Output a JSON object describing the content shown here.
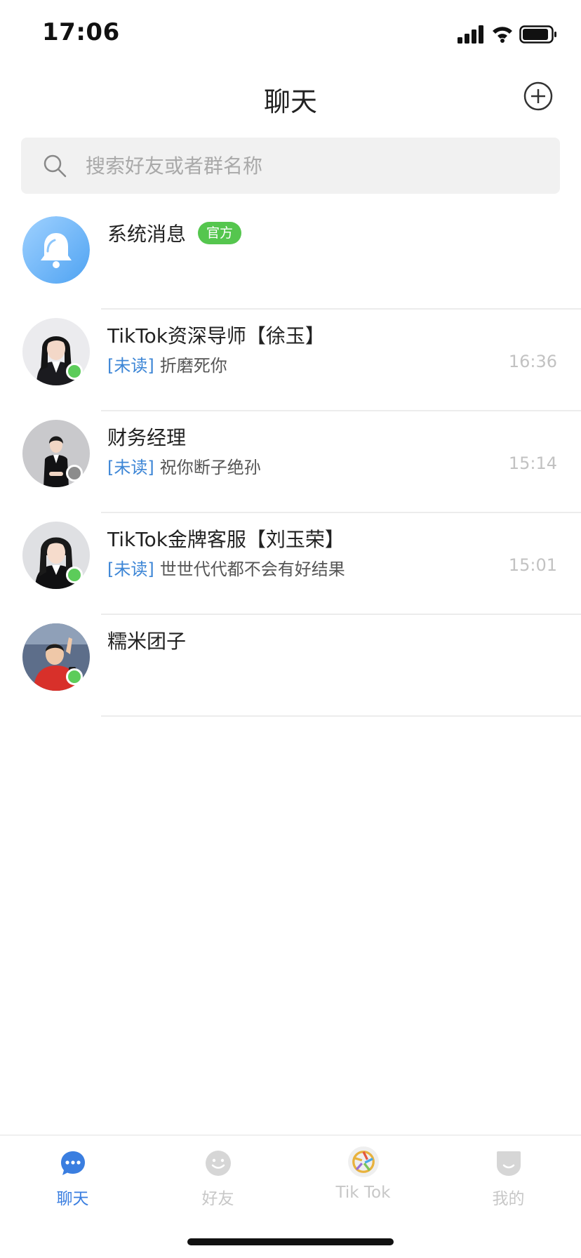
{
  "status_bar": {
    "time": "17:06"
  },
  "header": {
    "title": "聊天",
    "add_icon": "plus-circle-icon"
  },
  "search": {
    "placeholder": "搜索好友或者群名称",
    "icon": "search-icon"
  },
  "chats": [
    {
      "name": "系统消息",
      "badge": "官方",
      "unread_tag": "",
      "preview": "",
      "time": "",
      "online_status": "",
      "avatar": "bell"
    },
    {
      "name": "TikTok资深导师【徐玉】",
      "badge": "",
      "unread_tag": "[未读]",
      "preview": "折磨死你",
      "time": "16:36",
      "online_status": "online",
      "avatar": "woman-portrait"
    },
    {
      "name": "财务经理",
      "badge": "",
      "unread_tag": "[未读]",
      "preview": "祝你断子绝孙",
      "time": "15:14",
      "online_status": "offline",
      "avatar": "woman-suit"
    },
    {
      "name": "TikTok金牌客服【刘玉荣】",
      "badge": "",
      "unread_tag": "[未读]",
      "preview": "世世代代都不会有好结果",
      "time": "15:01",
      "online_status": "online",
      "avatar": "woman-portrait"
    },
    {
      "name": "糯米团子",
      "badge": "",
      "unread_tag": "",
      "preview": "",
      "time": "",
      "online_status": "online",
      "avatar": "man-red-shirt"
    }
  ],
  "nav": [
    {
      "label": "聊天",
      "icon": "chat-bubble-icon",
      "active": true
    },
    {
      "label": "好友",
      "icon": "smile-icon",
      "active": false
    },
    {
      "label": "Tik Tok",
      "icon": "aperture-icon",
      "active": false
    },
    {
      "label": "我的",
      "icon": "profile-icon",
      "active": false
    }
  ],
  "colors": {
    "accent": "#3a7ee0",
    "unread": "#3d86d6",
    "online": "#5ccc5a",
    "offline": "#8c8c8c",
    "badge": "#55c64e"
  }
}
